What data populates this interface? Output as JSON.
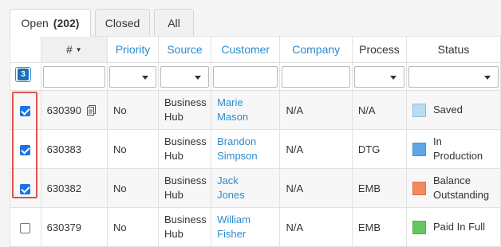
{
  "tabs": [
    {
      "label": "Open",
      "count": "(202)"
    },
    {
      "label": "Closed"
    },
    {
      "label": "All"
    }
  ],
  "columns": {
    "number": "#",
    "priority": "Priority",
    "source": "Source",
    "customer": "Customer",
    "company": "Company",
    "process": "Process",
    "status": "Status"
  },
  "selected_count": "3",
  "rows": [
    {
      "id": "630390",
      "priority": "No",
      "source_line1": "Business",
      "source_line2": "Hub",
      "customer_line1": "Marie",
      "customer_line2": "Mason",
      "company": "N/A",
      "process": "N/A",
      "status_line1": "Saved",
      "status_line2": "",
      "status_color": "#b9dcf2",
      "checked": true
    },
    {
      "id": "630383",
      "priority": "No",
      "source_line1": "Business",
      "source_line2": "Hub",
      "customer_line1": "Brandon",
      "customer_line2": "Simpson",
      "company": "N/A",
      "process": "DTG",
      "status_line1": "In",
      "status_line2": "Production",
      "status_color": "#5ba7ea",
      "checked": true
    },
    {
      "id": "630382",
      "priority": "No",
      "source_line1": "Business",
      "source_line2": "Hub",
      "customer_line1": "Jack",
      "customer_line2": "Jones",
      "company": "N/A",
      "process": "EMB",
      "status_line1": "Balance",
      "status_line2": "Outstanding",
      "status_color": "#f5895e",
      "checked": true
    },
    {
      "id": "630379",
      "priority": "No",
      "source_line1": "Business",
      "source_line2": "Hub",
      "customer_line1": "William",
      "customer_line2": "Fisher",
      "company": "N/A",
      "process": "EMB",
      "status_line1": "Paid In Full",
      "status_line2": "",
      "status_color": "#66c75f",
      "checked": false
    }
  ],
  "colors": {
    "link": "#2b8ccd",
    "highlight_border": "#e05252",
    "checkbox": "#1a73e8"
  }
}
